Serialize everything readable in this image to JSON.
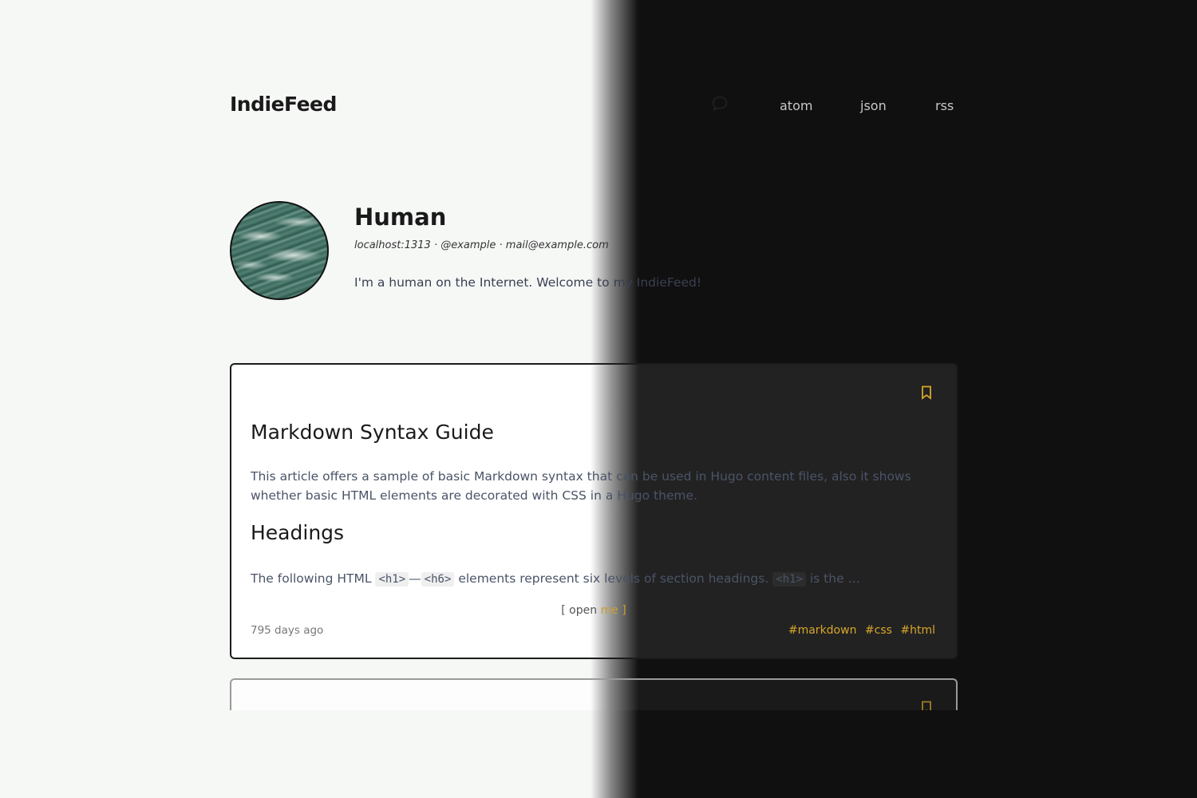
{
  "site": {
    "title": "IndieFeed"
  },
  "nav": {
    "items": [
      {
        "label": "atom"
      },
      {
        "label": "json"
      },
      {
        "label": "rss"
      }
    ],
    "icon": "speech-bubble-icon"
  },
  "profile": {
    "name": "Human",
    "meta": "localhost:1313 · @example · mail@example.com",
    "bio": "I'm a human on the Internet. Welcome to my IndieFeed!"
  },
  "post": {
    "title": "Markdown Syntax Guide",
    "summary": "This article offers a sample of basic Markdown syntax that can be used in Hugo content files, also it shows whether basic HTML elements are decorated with CSS in a Hugo theme.",
    "subheading": "Headings",
    "excerpt_prefix": "The following HTML",
    "code_h1": "<h1>",
    "dash": "—",
    "code_h6": "<h6>",
    "excerpt_middle": "elements represent six levels of section headings.",
    "code_h1_again": "<h1>",
    "excerpt_suffix": "is the …",
    "open_bracket_left": "[ ",
    "open_label_a": "open ",
    "open_label_b": "me",
    "open_bracket_right": " ]",
    "date": "795 days ago",
    "tags": [
      "#markdown",
      "#css",
      "#html"
    ]
  },
  "colors": {
    "accent": "#d8a72a",
    "light_bg": "#f6f8f6",
    "dark_bg": "#101010"
  }
}
